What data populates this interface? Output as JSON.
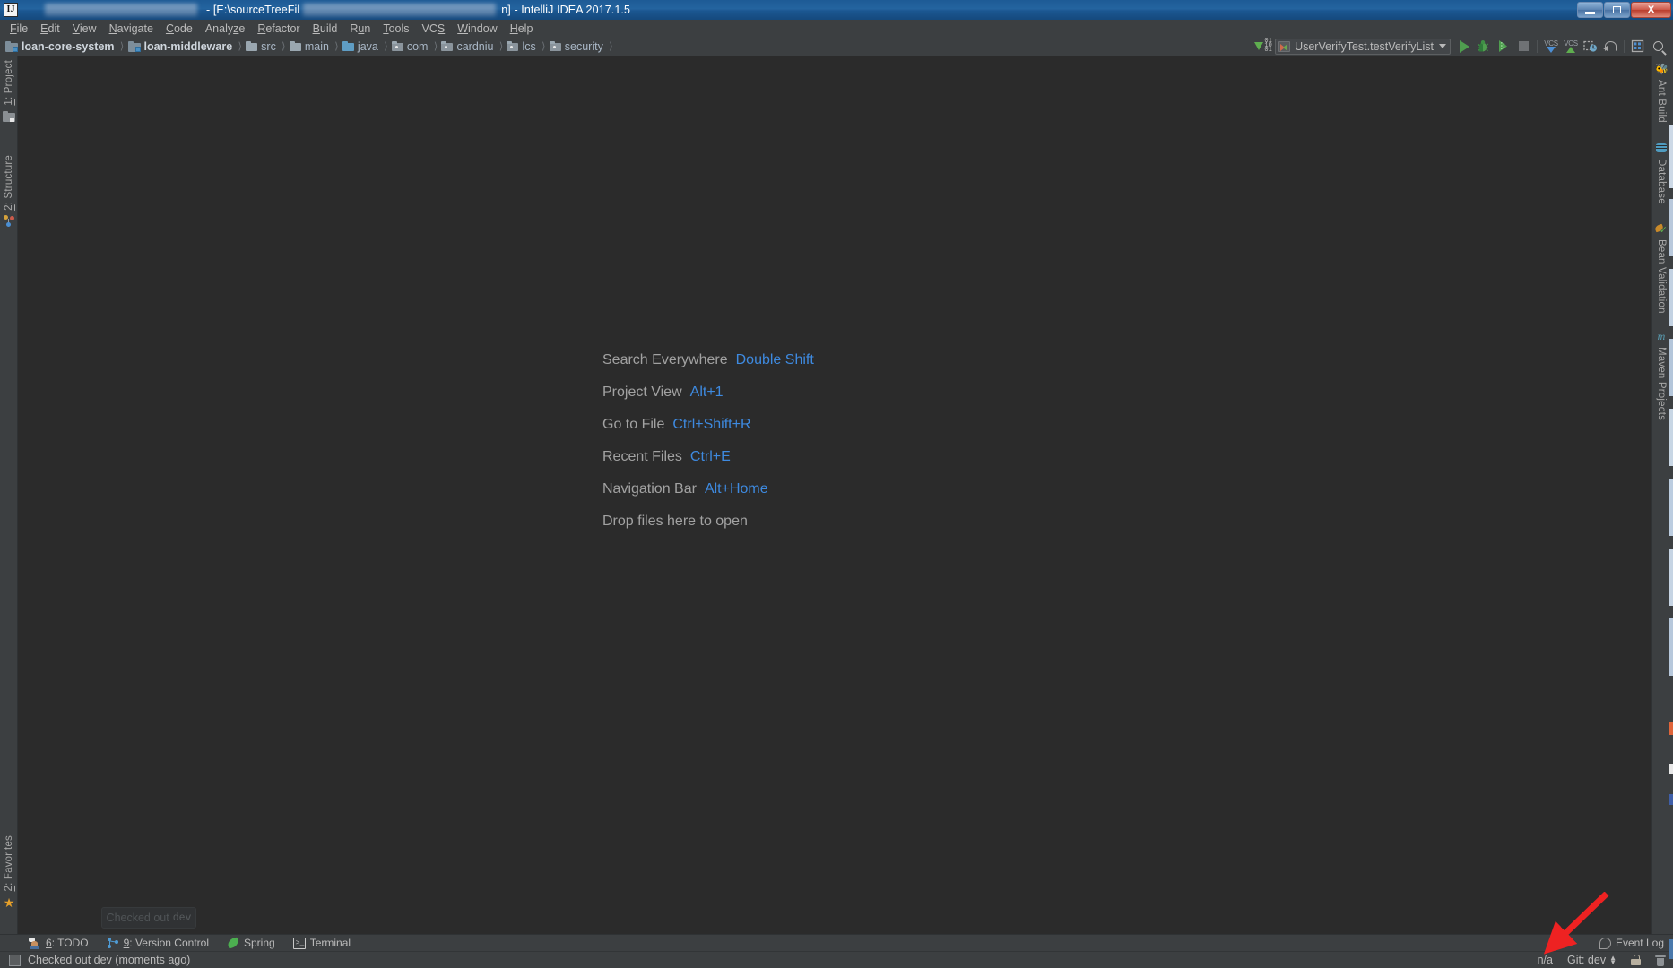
{
  "window": {
    "title_visible_parts": [
      "- [E:\\sourceTreeFil",
      "n] - IntelliJ IDEA 2017.1.5"
    ],
    "title_full": "- [E:\\sourceTreeFil     n] - IntelliJ IDEA 2017.1.5",
    "app_icon_label": "IJ",
    "controls": {
      "minimize": "Minimize",
      "maximize": "Restore",
      "close": "X"
    }
  },
  "menubar": {
    "items": [
      {
        "label": "File",
        "mnemonic": "F"
      },
      {
        "label": "Edit",
        "mnemonic": "E"
      },
      {
        "label": "View",
        "mnemonic": "V"
      },
      {
        "label": "Navigate",
        "mnemonic": "N"
      },
      {
        "label": "Code",
        "mnemonic": "C"
      },
      {
        "label": "Analyze",
        "mnemonic": "z"
      },
      {
        "label": "Refactor",
        "mnemonic": "R"
      },
      {
        "label": "Build",
        "mnemonic": "B"
      },
      {
        "label": "Run",
        "mnemonic": "u"
      },
      {
        "label": "Tools",
        "mnemonic": "T"
      },
      {
        "label": "VCS",
        "mnemonic": "S"
      },
      {
        "label": "Window",
        "mnemonic": "W"
      },
      {
        "label": "Help",
        "mnemonic": "H"
      }
    ]
  },
  "navbar": {
    "crumbs": [
      {
        "label": "loan-core-system",
        "icon": "module-icon",
        "bold": true
      },
      {
        "label": "loan-middleware",
        "icon": "module-icon",
        "bold": true
      },
      {
        "label": "src",
        "icon": "folder-icon",
        "bold": false
      },
      {
        "label": "main",
        "icon": "folder-icon",
        "bold": false
      },
      {
        "label": "java",
        "icon": "folder-source-icon",
        "bold": false
      },
      {
        "label": "com",
        "icon": "folder-package-icon",
        "bold": false
      },
      {
        "label": "cardniu",
        "icon": "folder-package-icon",
        "bold": false
      },
      {
        "label": "lcs",
        "icon": "folder-package-icon",
        "bold": false
      },
      {
        "label": "security",
        "icon": "folder-package-icon",
        "bold": false
      }
    ],
    "separator": "〉",
    "run_config": {
      "name": "UserVerifyTest.testVerifyList",
      "icon": "run-config-icon",
      "dropdown": "chevron-down-icon"
    },
    "actions": [
      {
        "name": "update-project-icon",
        "label": "Update Project",
        "digits": [
          "01",
          "10",
          "01"
        ]
      },
      {
        "name": "run-icon",
        "label": "Run"
      },
      {
        "name": "debug-icon",
        "label": "Debug"
      },
      {
        "name": "run-with-coverage-icon",
        "label": "Run with Coverage"
      },
      {
        "name": "stop-icon",
        "label": "Stop"
      },
      {
        "name": "vcs-update-icon",
        "label": "VCS"
      },
      {
        "name": "vcs-commit-icon",
        "label": "VCS"
      },
      {
        "name": "vcs-history-icon",
        "label": "History"
      },
      {
        "name": "revert-icon",
        "label": "Revert"
      },
      {
        "name": "settings-icon",
        "label": "Settings"
      },
      {
        "name": "search-icon",
        "label": "Search Everywhere"
      }
    ]
  },
  "editor": {
    "welcome_rows": [
      {
        "label": "Search Everywhere",
        "shortcut": "Double Shift"
      },
      {
        "label": "Project View",
        "shortcut": "Alt+1"
      },
      {
        "label": "Go to File",
        "shortcut": "Ctrl+Shift+R"
      },
      {
        "label": "Recent Files",
        "shortcut": "Ctrl+E"
      },
      {
        "label": "Navigation Bar",
        "shortcut": "Alt+Home"
      },
      {
        "label": "Drop files here to open",
        "shortcut": ""
      }
    ],
    "label_color": "#a2a2a2",
    "shortcut_color": "#3e8ae0",
    "background_color": "#2b2b2b"
  },
  "left_stripe": {
    "top_items": [
      {
        "label": "1: Project",
        "mnemonic": "1",
        "icon": "project-folder-icon"
      },
      {
        "label": "2: Structure",
        "mnemonic": "2",
        "icon": "structure-icon"
      }
    ],
    "bottom_items": [
      {
        "label": "2: Favorites",
        "mnemonic": "2",
        "icon": "star-icon"
      }
    ]
  },
  "right_stripe": {
    "items": [
      {
        "label": "Ant Build",
        "icon": "ant-icon"
      },
      {
        "label": "Database",
        "icon": "database-icon"
      },
      {
        "label": "Bean Validation",
        "icon": "bean-validation-icon"
      },
      {
        "label": "Maven Projects",
        "icon": "maven-icon"
      }
    ]
  },
  "bottom_bar": {
    "tabs": [
      {
        "label": "6: TODO",
        "mnemonic": "6",
        "icon": "todo-icon"
      },
      {
        "label": "9: Version Control",
        "mnemonic": "9",
        "icon": "version-control-icon"
      },
      {
        "label": "Spring",
        "mnemonic": "",
        "icon": "spring-leaf-icon"
      },
      {
        "label": "Terminal",
        "mnemonic": "",
        "icon": "terminal-icon"
      }
    ],
    "event_log": {
      "label": "Event Log",
      "icon": "event-log-icon"
    }
  },
  "statusbar": {
    "message": "Checked out dev (moments ago)",
    "message_icon": "status-square-icon",
    "right_items": [
      {
        "label": "n/a",
        "name": "caret-position"
      },
      {
        "label": "Git: dev",
        "name": "git-branch-widget",
        "has_updown": true
      },
      {
        "label": "",
        "name": "lock-icon"
      },
      {
        "label": "",
        "name": "memory-trash-icon"
      }
    ]
  },
  "balloon": {
    "text": "Checked out",
    "branch": "dev"
  },
  "annotation": {
    "arrow_color": "#ee2222",
    "points_to": "Event Log"
  },
  "colors": {
    "titlebar_blue": "#1d5a95",
    "chrome": "#3c3f41",
    "editor_bg": "#2b2b2b",
    "text": "#bbbbbb",
    "link": "#3e8ae0"
  }
}
